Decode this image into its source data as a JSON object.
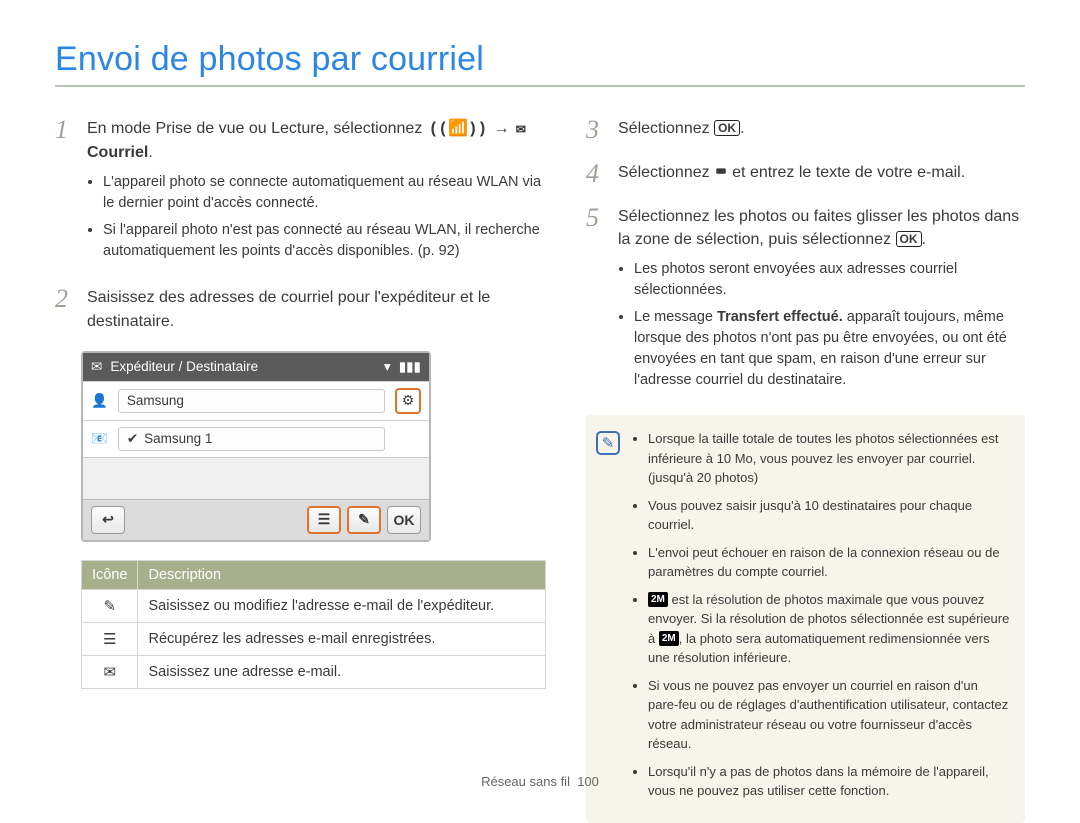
{
  "title": "Envoi de photos par courriel",
  "left": {
    "step1": {
      "text_a": "En mode Prise de vue ou Lecture, sélectionnez ",
      "text_b": " → ",
      "text_c": " Courriel",
      "text_d": ".",
      "bullets": [
        "L'appareil photo se connecte automatiquement au réseau WLAN via le dernier point d'accès connecté.",
        "Si l'appareil photo n'est pas connecté au réseau WLAN, il recherche automatiquement les points d'accès disponibles. (p. 92)"
      ]
    },
    "step2": {
      "text": "Saisissez des adresses de courriel pour l'expéditeur et le destinataire."
    },
    "ui": {
      "header": "Expéditeur / Destinataire",
      "sender": "Samsung",
      "recipient": "Samsung 1"
    },
    "table": {
      "head_icon": "Icône",
      "head_desc": "Description",
      "rows": [
        {
          "icon": "✎",
          "desc": "Saisissez ou modifiez l'adresse e-mail de l'expéditeur."
        },
        {
          "icon": "☰",
          "desc": "Récupérez les adresses e-mail enregistrées."
        },
        {
          "icon": "✉",
          "desc": "Saisissez une adresse e-mail."
        }
      ]
    }
  },
  "right": {
    "step3": {
      "text_a": "Sélectionnez ",
      "text_b": "."
    },
    "step4": {
      "text_a": "Sélectionnez ",
      "text_b": " et entrez le texte de votre e-mail."
    },
    "step5": {
      "text_a": "Sélectionnez les photos ou faites glisser les photos dans la zone de sélection, puis sélectionnez ",
      "text_b": ".",
      "bullets_a": "Les photos seront envoyées aux adresses courriel sélectionnées.",
      "bullets_b_pre": "Le message ",
      "bullets_b_bold": "Transfert effectué.",
      "bullets_b_post": " apparaît toujours, même lorsque des photos n'ont pas pu être envoyées, ou ont été envoyées en tant que spam, en raison d'une erreur sur l'adresse courriel du destinataire."
    },
    "info": [
      "Lorsque la taille totale de toutes les photos sélectionnées est inférieure à 10 Mo, vous pouvez les envoyer par courriel. (jusqu'à 20 photos)",
      "Vous pouvez saisir jusqu'à 10 destinataires pour chaque courriel.",
      "L'envoi peut échouer en raison de la connexion réseau ou de paramètres du compte courriel.",
      {
        "pre": "",
        "res": "2M",
        "mid": " est la résolution de photos maximale que vous pouvez envoyer. Si la résolution de photos sélectionnée est supérieure à ",
        "res2": "2M",
        "post": ", la photo sera automatiquement redimensionnée vers une résolution inférieure."
      },
      "Si vous ne pouvez pas envoyer un courriel en raison d'un pare-feu ou de réglages d'authentification utilisateur, contactez votre administrateur réseau ou votre fournisseur d'accès réseau.",
      "Lorsqu'il n'y a pas de photos dans la mémoire de l'appareil, vous ne pouvez pas utiliser cette fonction."
    ]
  },
  "footer_a": "Réseau sans fil",
  "footer_b": "100",
  "ok": "OK"
}
